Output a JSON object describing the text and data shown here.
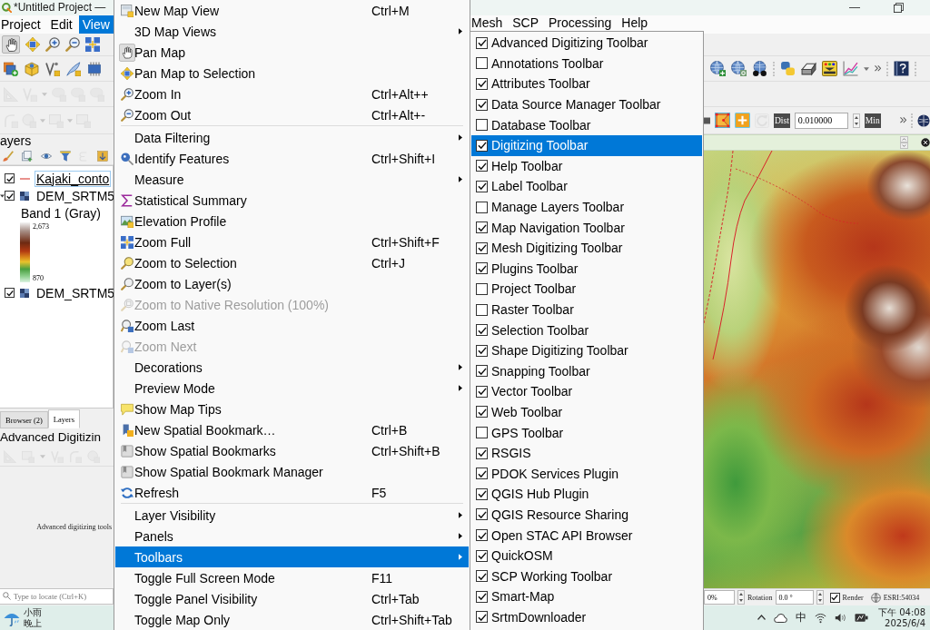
{
  "title_bar": {
    "title": "*Untitled Project —"
  },
  "menu_bar": {
    "items_left": [
      {
        "label": "Project",
        "selected": false
      },
      {
        "label": "Edit",
        "selected": false
      },
      {
        "label": "View",
        "selected": true
      }
    ],
    "items_right": [
      {
        "label": "Mesh",
        "selected": false
      },
      {
        "label": "SCP",
        "selected": false
      },
      {
        "label": "Processing",
        "selected": false
      },
      {
        "label": "Help",
        "selected": false
      }
    ]
  },
  "navigation_toolbar": {
    "pan_checked": true
  },
  "layers_panel": {
    "title": "ayers",
    "layers": [
      {
        "kind": "vector",
        "name": "Kajaki_conto",
        "checked": true,
        "selected": true
      },
      {
        "kind": "raster",
        "name": "DEM_SRTM5",
        "checked": true,
        "selected": false,
        "expanded": true,
        "children": [
          {
            "kind": "band",
            "name": "Band 1 (Gray)",
            "legend_max": "2,673",
            "legend_min": "870"
          }
        ]
      },
      {
        "kind": "raster",
        "name": "DEM_SRTM5",
        "checked": true,
        "selected": false
      }
    ]
  },
  "dock_tabs": [
    {
      "label": "Browser (2)",
      "selected": false
    },
    {
      "label": "Layers",
      "selected": true
    }
  ],
  "advanced_digitizing_panel": {
    "title": "Advanced Digitizin",
    "message": "Advanced digitizing tools"
  },
  "locator": {
    "placeholder": "Type to locate (Ctrl+K)"
  },
  "view_menu": {
    "items": [
      {
        "kind": "action",
        "label": "New Map View",
        "shortcut": "Ctrl+M",
        "checked": false,
        "disabled": false,
        "selected": false
      },
      {
        "kind": "submenu",
        "label": "3D Map Views",
        "checked": false,
        "disabled": false,
        "selected": false
      },
      {
        "kind": "action",
        "label": "Pan Map",
        "checked": true,
        "disabled": false,
        "selected": false
      },
      {
        "kind": "action",
        "label": "Pan Map to Selection",
        "checked": false,
        "disabled": false,
        "selected": false
      },
      {
        "kind": "action",
        "label": "Zoom In",
        "shortcut": "Ctrl+Alt++",
        "checked": false,
        "disabled": false,
        "selected": false
      },
      {
        "kind": "action",
        "label": "Zoom Out",
        "shortcut": "Ctrl+Alt+-",
        "checked": false,
        "disabled": false,
        "selected": false
      },
      {
        "kind": "separator"
      },
      {
        "kind": "submenu",
        "label": "Data Filtering",
        "checked": false,
        "disabled": false,
        "selected": false
      },
      {
        "kind": "action",
        "label": "Identify Features",
        "shortcut": "Ctrl+Shift+I",
        "checked": false,
        "disabled": false,
        "selected": false
      },
      {
        "kind": "submenu",
        "label": "Measure",
        "checked": false,
        "disabled": false,
        "selected": false
      },
      {
        "kind": "action",
        "label": "Statistical Summary",
        "checked": false,
        "disabled": false,
        "selected": false
      },
      {
        "kind": "action",
        "label": "Elevation Profile",
        "checked": false,
        "disabled": false,
        "selected": false
      },
      {
        "kind": "action",
        "label": "Zoom Full",
        "shortcut": "Ctrl+Shift+F",
        "checked": false,
        "disabled": false,
        "selected": false
      },
      {
        "kind": "action",
        "label": "Zoom to Selection",
        "shortcut": "Ctrl+J",
        "checked": false,
        "disabled": false,
        "selected": false
      },
      {
        "kind": "action",
        "label": "Zoom to Layer(s)",
        "checked": false,
        "disabled": false,
        "selected": false
      },
      {
        "kind": "action",
        "label": "Zoom to Native Resolution (100%)",
        "checked": false,
        "disabled": true,
        "selected": false
      },
      {
        "kind": "action",
        "label": "Zoom Last",
        "checked": false,
        "disabled": false,
        "selected": false
      },
      {
        "kind": "action",
        "label": "Zoom Next",
        "checked": false,
        "disabled": true,
        "selected": false
      },
      {
        "kind": "submenu",
        "label": "Decorations",
        "checked": false,
        "disabled": false,
        "selected": false
      },
      {
        "kind": "submenu",
        "label": "Preview Mode",
        "checked": false,
        "disabled": false,
        "selected": false
      },
      {
        "kind": "action",
        "label": "Show Map Tips",
        "checked": false,
        "disabled": false,
        "selected": false
      },
      {
        "kind": "action",
        "label": "New Spatial Bookmark…",
        "shortcut": "Ctrl+B",
        "checked": false,
        "disabled": false,
        "selected": false
      },
      {
        "kind": "action",
        "label": "Show Spatial Bookmarks",
        "shortcut": "Ctrl+Shift+B",
        "checked": false,
        "disabled": false,
        "selected": false
      },
      {
        "kind": "action",
        "label": "Show Spatial Bookmark Manager",
        "checked": false,
        "disabled": false,
        "selected": false
      },
      {
        "kind": "action",
        "label": "Refresh",
        "shortcut": "F5",
        "checked": false,
        "disabled": false,
        "selected": false
      },
      {
        "kind": "separator"
      },
      {
        "kind": "submenu",
        "label": "Layer Visibility",
        "checked": false,
        "disabled": false,
        "selected": false
      },
      {
        "kind": "submenu",
        "label": "Panels",
        "checked": false,
        "disabled": false,
        "selected": false
      },
      {
        "kind": "submenu",
        "label": "Toolbars",
        "checked": false,
        "disabled": false,
        "selected": true
      },
      {
        "kind": "action",
        "label": "Toggle Full Screen Mode",
        "shortcut": "F11",
        "checked": false,
        "disabled": false,
        "selected": false
      },
      {
        "kind": "action",
        "label": "Toggle Panel Visibility",
        "shortcut": "Ctrl+Tab",
        "checked": false,
        "disabled": false,
        "selected": false
      },
      {
        "kind": "action",
        "label": "Toggle Map Only",
        "shortcut": "Ctrl+Shift+Tab",
        "checked": false,
        "disabled": false,
        "selected": false
      }
    ]
  },
  "toolbars_submenu": {
    "items": [
      {
        "label": "Advanced Digitizing Toolbar",
        "checked": true,
        "selected": false
      },
      {
        "label": "Annotations Toolbar",
        "checked": false,
        "selected": false
      },
      {
        "label": "Attributes Toolbar",
        "checked": true,
        "selected": false
      },
      {
        "label": "Data Source Manager Toolbar",
        "checked": true,
        "selected": false
      },
      {
        "label": "Database Toolbar",
        "checked": false,
        "selected": false
      },
      {
        "label": "Digitizing Toolbar",
        "checked": true,
        "selected": true
      },
      {
        "label": "Help Toolbar",
        "checked": true,
        "selected": false
      },
      {
        "label": "Label Toolbar",
        "checked": true,
        "selected": false
      },
      {
        "label": "Manage Layers Toolbar",
        "checked": false,
        "selected": false
      },
      {
        "label": "Map Navigation Toolbar",
        "checked": true,
        "selected": false
      },
      {
        "label": "Mesh Digitizing Toolbar",
        "checked": true,
        "selected": false
      },
      {
        "label": "Plugins Toolbar",
        "checked": true,
        "selected": false
      },
      {
        "label": "Project Toolbar",
        "checked": false,
        "selected": false
      },
      {
        "label": "Raster Toolbar",
        "checked": false,
        "selected": false
      },
      {
        "label": "Selection Toolbar",
        "checked": true,
        "selected": false
      },
      {
        "label": "Shape Digitizing Toolbar",
        "checked": true,
        "selected": false
      },
      {
        "label": "Snapping Toolbar",
        "checked": true,
        "selected": false
      },
      {
        "label": "Vector Toolbar",
        "checked": true,
        "selected": false
      },
      {
        "label": "Web Toolbar",
        "checked": true,
        "selected": false
      },
      {
        "label": "GPS Toolbar",
        "checked": false,
        "selected": false
      },
      {
        "label": "RSGIS",
        "checked": true,
        "selected": false
      },
      {
        "label": "PDOK Services Plugin",
        "checked": true,
        "selected": false
      },
      {
        "label": "QGIS Hub Plugin",
        "checked": true,
        "selected": false
      },
      {
        "label": "QGIS Resource Sharing",
        "checked": true,
        "selected": false
      },
      {
        "label": "Open STAC API Browser",
        "checked": true,
        "selected": false
      },
      {
        "label": "QuickOSM",
        "checked": true,
        "selected": false
      },
      {
        "label": "SCP Working Toolbar",
        "checked": true,
        "selected": false
      },
      {
        "label": "Smart-Map",
        "checked": true,
        "selected": false
      },
      {
        "label": "SrtmDownloader",
        "checked": true,
        "selected": false
      }
    ]
  },
  "map_toolbar": {
    "distance_label": "Dist",
    "distance": "0.010000",
    "unit_label": "Min"
  },
  "status_bar": {
    "scale": "0%",
    "rotation_label": "Rotation",
    "rotation": "0.0 °",
    "render": {
      "label": "Render",
      "checked": true
    },
    "crs": "ESRI:54034"
  },
  "taskbar": {
    "weather": {
      "condition": "小雨",
      "period": "晚上"
    },
    "input_mode": "中",
    "time": "下午 04:08",
    "date": "2025/6/4"
  }
}
